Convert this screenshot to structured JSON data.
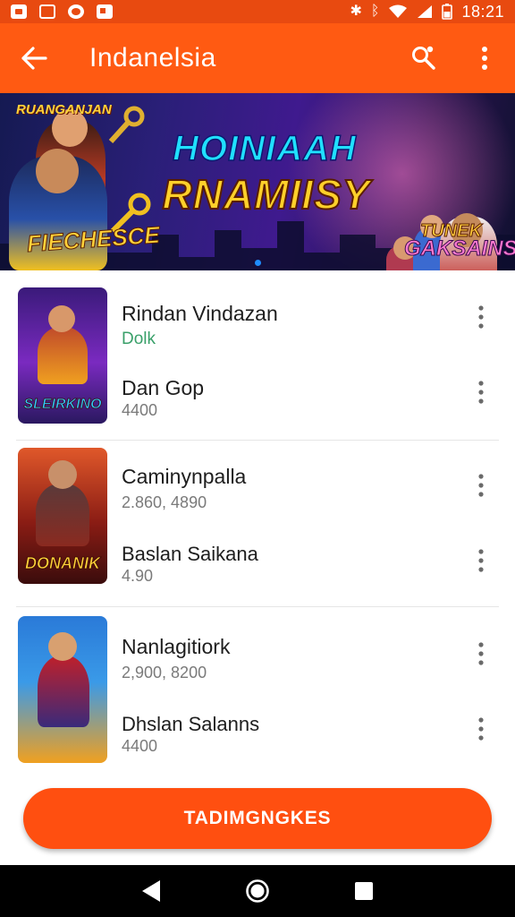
{
  "status_bar": {
    "time": "18:21",
    "icons": [
      "notification-icon",
      "gallery-icon",
      "app-icon",
      "photo-icon",
      "bluetooth-icon",
      "wifi-icon",
      "signal-icon",
      "battery-icon"
    ]
  },
  "app_bar": {
    "title": "Indanelsia",
    "back_icon": "arrow-left-icon",
    "share_icon": "share-icon",
    "more_icon": "more-vertical-icon",
    "color": "#ff5a12"
  },
  "banner": {
    "tag": "RUANGANJAN",
    "headline_1": "HOINIAAH",
    "headline_2": "RNAMIISY",
    "left_sub": "FIECHESCE",
    "right_sub_1": "TUNEK",
    "right_sub_2": "GAKSAINS"
  },
  "list": [
    {
      "thumb_label": "SLEIRKINO",
      "rows": [
        {
          "title": "Rindan Vindazan",
          "subtitle": "Dolk",
          "subtitle_style": "green"
        },
        {
          "title": "Dan Gop",
          "subtitle": "4400"
        }
      ]
    },
    {
      "thumb_label": "DONANIK",
      "rows": [
        {
          "title": "Caminynpalla",
          "subtitle": "2.860, 4890"
        },
        {
          "title": "Baslan Saikana",
          "subtitle": "4.90"
        }
      ]
    },
    {
      "thumb_label": "",
      "rows": [
        {
          "title": "Nanlagitiork",
          "subtitle": "2,900, 8200"
        },
        {
          "title": "Dhslan Salanns",
          "subtitle": "4400"
        }
      ]
    }
  ],
  "cta": {
    "label": "TADIMGNGKES",
    "color": "#ff4f10"
  },
  "nav": {
    "back_icon": "nav-back-icon",
    "home_icon": "nav-home-icon",
    "recents_icon": "nav-recents-icon"
  }
}
